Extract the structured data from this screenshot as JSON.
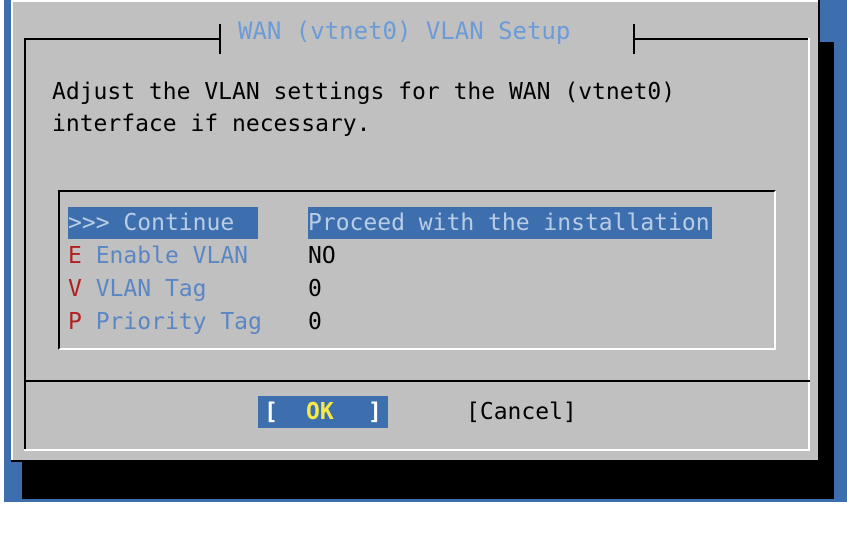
{
  "dialog": {
    "title": "WAN (vtnet0) VLAN Setup",
    "message_line1": "Adjust the VLAN settings for the WAN (vtnet0)",
    "message_line2": "interface if necessary."
  },
  "menu": {
    "items": [
      {
        "hotkey": ">",
        "label": ">> Continue",
        "value": "Proceed with the installation",
        "selected": true
      },
      {
        "hotkey": "E",
        "label": " Enable VLAN",
        "value": "NO",
        "selected": false
      },
      {
        "hotkey": "V",
        "label": " VLAN Tag",
        "value": "0",
        "selected": false
      },
      {
        "hotkey": "P",
        "label": " Priority Tag",
        "value": "0",
        "selected": false
      }
    ]
  },
  "buttons": {
    "ok_open": "[",
    "ok_label": "OK",
    "ok_close": "]",
    "cancel_label": "[Cancel]"
  },
  "colors": {
    "background": "#3d6fae",
    "dialog": "#c0c0c0",
    "title_text": "#6c9bd7",
    "hotkey": "#b02020",
    "ok_label": "#f6e845"
  }
}
